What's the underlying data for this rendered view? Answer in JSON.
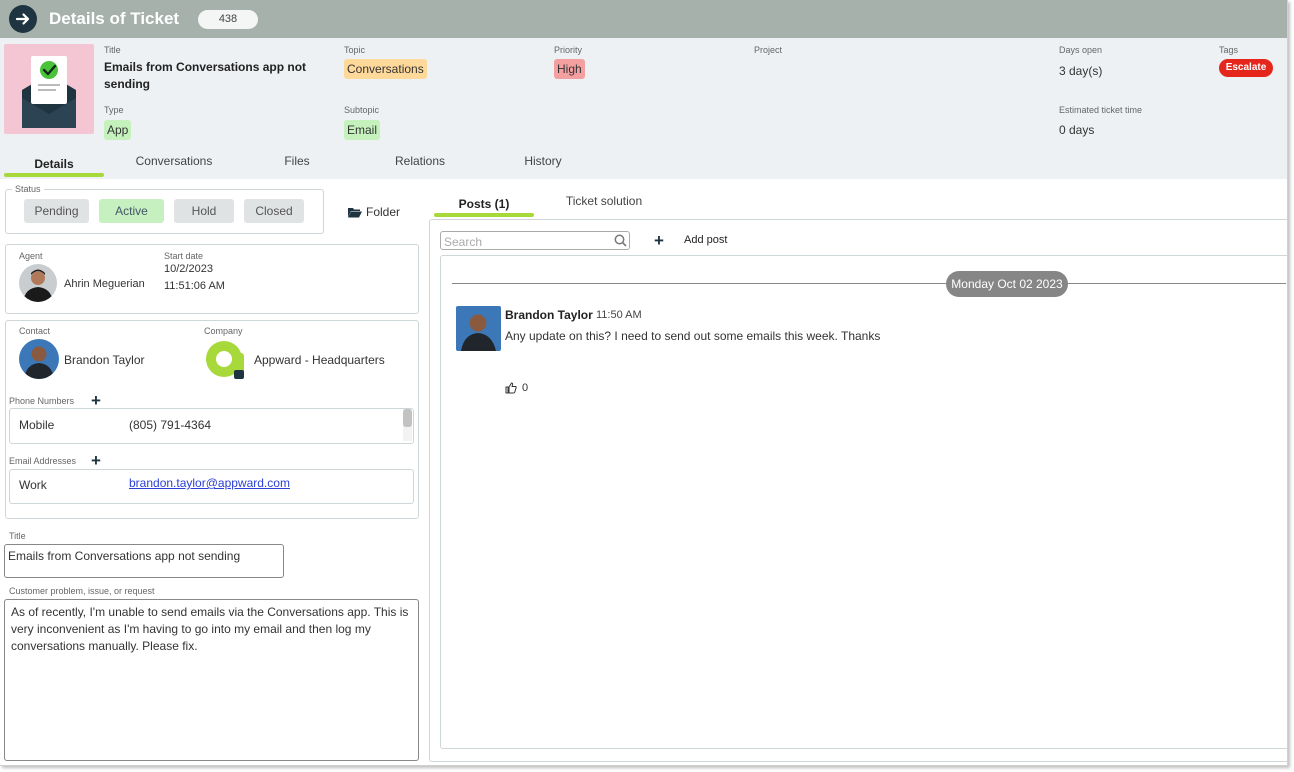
{
  "topbar": {
    "title": "Details of Ticket",
    "ticket_number": "438"
  },
  "header": {
    "title_label": "Title",
    "title_value": "Emails from Conversations app not sending",
    "topic_label": "Topic",
    "topic_value": "Conversations",
    "priority_label": "Priority",
    "priority_value": "High",
    "project_label": "Project",
    "days_open_label": "Days open",
    "days_open_value": "3 day(s)",
    "tags_label": "Tags",
    "tag_value": "Escalate",
    "type_label": "Type",
    "type_value": "App",
    "subtopic_label": "Subtopic",
    "subtopic_value": "Email",
    "est_time_label": "Estimated ticket time",
    "est_time_value": "0 days"
  },
  "tabs": [
    "Details",
    "Conversations",
    "Files",
    "Relations",
    "History"
  ],
  "status": {
    "label": "Status",
    "options": [
      "Pending",
      "Active",
      "Hold",
      "Closed"
    ],
    "selected": "Active",
    "folder_label": "Folder"
  },
  "agent": {
    "label": "Agent",
    "name": "Ahrin Meguerian",
    "start_label": "Start date",
    "start_date": "10/2/2023",
    "start_time": "11:51:06 AM"
  },
  "contact": {
    "label": "Contact",
    "name": "Brandon Taylor",
    "company_label": "Company",
    "company": "Appward - Headquarters",
    "phone_label": "Phone Numbers",
    "phone_type": "Mobile",
    "phone": "(805) 791-4364",
    "email_label": "Email Addresses",
    "email_type": "Work",
    "email": "brandon.taylor@appward.com"
  },
  "form": {
    "title_label": "Title",
    "title_value": "Emails from Conversations app not sending",
    "problem_label": "Customer problem, issue, or request",
    "problem_value": "As of recently, I'm unable to send emails via the Conversations app. This is very inconvenient as I'm having to go into my email and then log my conversations manually. Please fix."
  },
  "right_tabs": [
    "Posts (1)",
    "Ticket solution"
  ],
  "posts": {
    "search_placeholder": "Search",
    "add_post_label": "Add post",
    "date_divider": "Monday Oct 02 2023",
    "author": "Brandon Taylor",
    "time": "11:50 AM",
    "message": "Any update on this? I need to send out some emails this week. Thanks",
    "likes": "0"
  },
  "colors": {
    "topbar": "#a7b1ac",
    "header_bg": "#edf1f3",
    "accent_green": "#a8d93a",
    "escalate_red": "#e4261c"
  }
}
